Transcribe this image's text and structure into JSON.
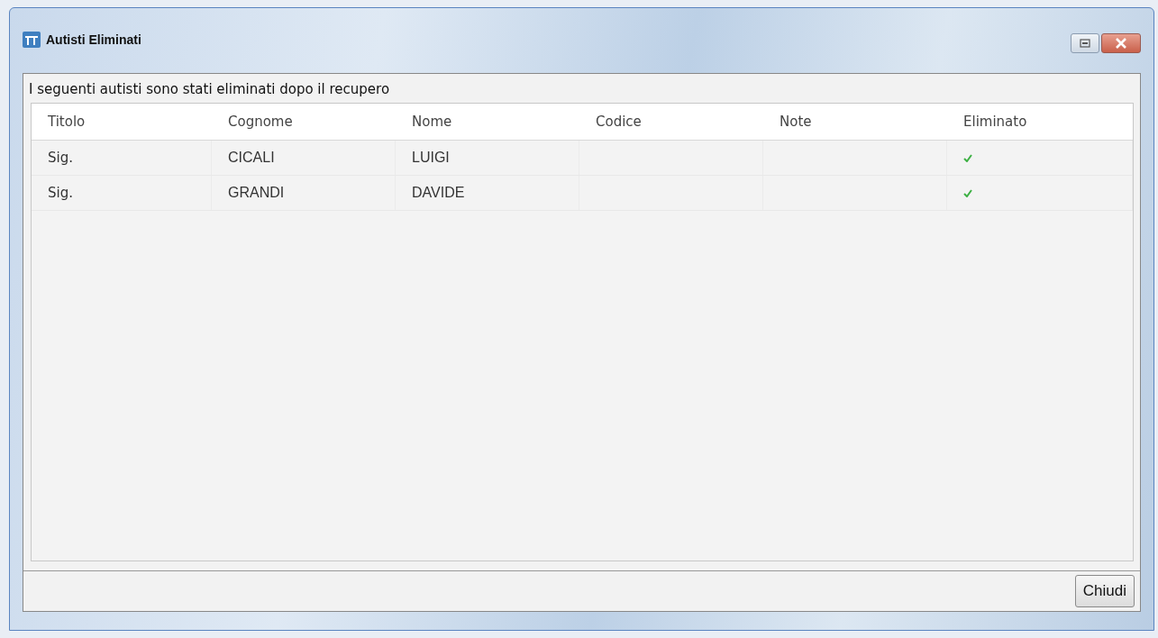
{
  "window": {
    "title": "Autisti Eliminati"
  },
  "message": "I seguenti autisti sono stati eliminati dopo il recupero",
  "table": {
    "columns": [
      "Titolo",
      "Cognome",
      "Nome",
      "Codice",
      "Note",
      "Eliminato"
    ],
    "rows": [
      {
        "titolo": "Sig.",
        "cognome": "CICALI",
        "nome": "LUIGI",
        "eliminato": true
      },
      {
        "titolo": "Sig.",
        "cognome": "GRANDI",
        "nome": "DAVIDE",
        "eliminato": true
      }
    ]
  },
  "buttons": [
    "Chiudi"
  ]
}
